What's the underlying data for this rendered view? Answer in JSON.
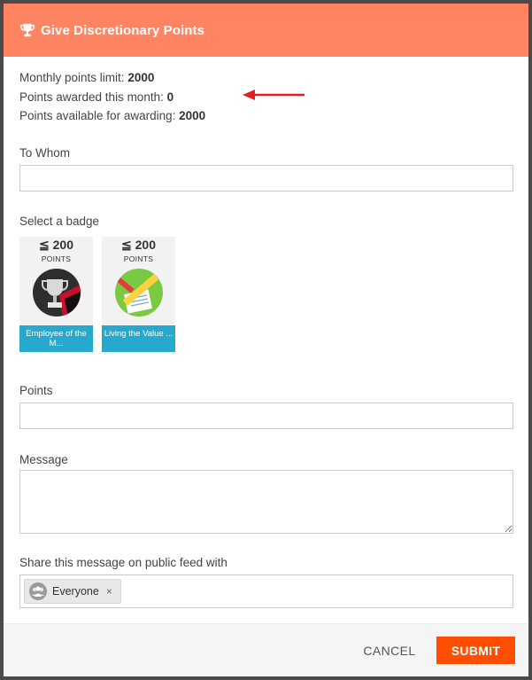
{
  "header": {
    "title": "Give Discretionary Points",
    "icon": "trophy-icon"
  },
  "stats": {
    "monthly_limit_label": "Monthly points limit:",
    "monthly_limit_value": "2000",
    "awarded_label": "Points awarded this month:",
    "awarded_value": "0",
    "available_label": "Points available for awarding:",
    "available_value": "2000"
  },
  "form": {
    "to_whom_label": "To Whom",
    "to_whom_value": "",
    "select_badge_label": "Select a badge",
    "points_label": "Points",
    "points_value": "",
    "message_label": "Message",
    "message_value": "",
    "share_label": "Share this message on public feed with"
  },
  "badges": [
    {
      "points": "≦ 200",
      "points_label": "POINTS",
      "caption": "Employee of the M...",
      "icon": "trophy-badge-icon"
    },
    {
      "points": "≦ 200",
      "points_label": "POINTS",
      "caption": "Living the Value ...",
      "icon": "pencil-document-badge-icon"
    }
  ],
  "share_chip": {
    "label": "Everyone",
    "remove": "×",
    "icon": "group-icon"
  },
  "footer": {
    "cancel_label": "CANCEL",
    "submit_label": "SUBMIT"
  },
  "colors": {
    "header": "#ff8462",
    "submit": "#ff4e00",
    "badge_caption": "#27a9cf",
    "arrow": "#e41e1e"
  }
}
